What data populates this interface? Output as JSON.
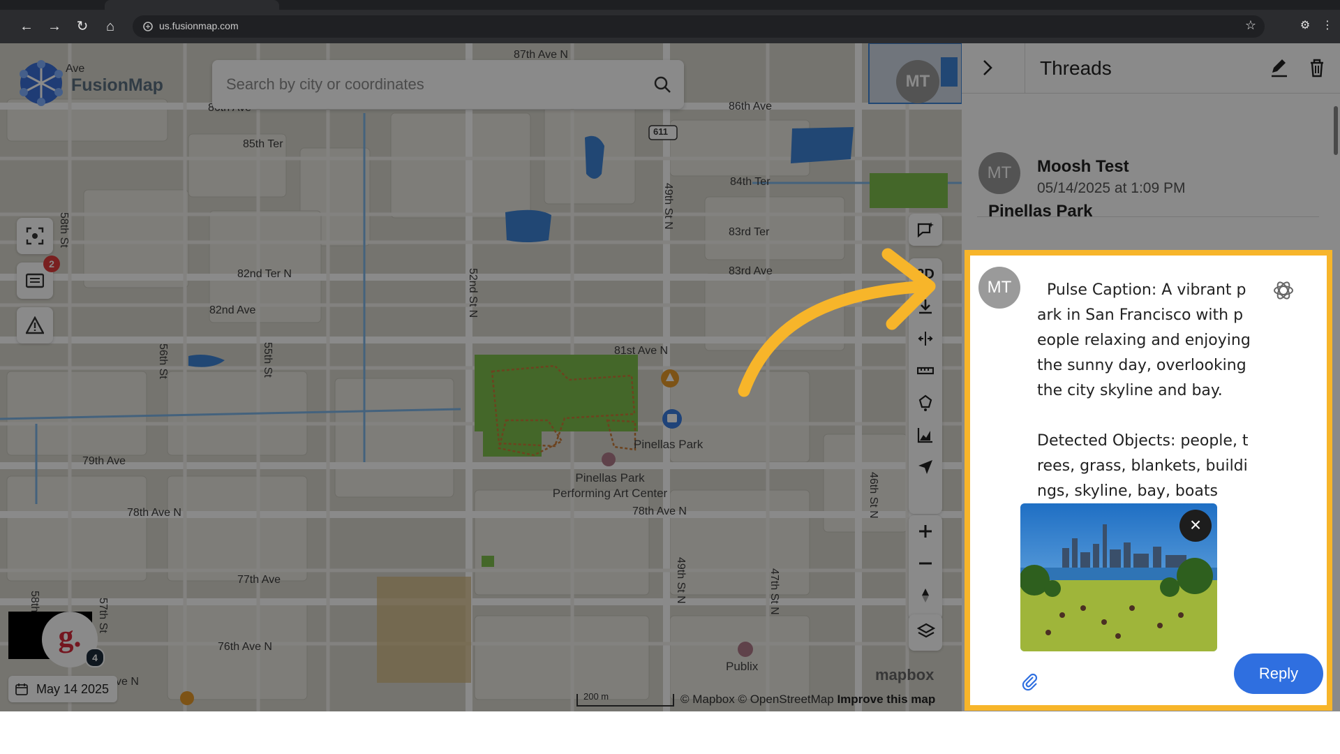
{
  "browser": {
    "url": "us.fusionmap.com"
  },
  "app": {
    "logo_text": "FusionMap",
    "search_placeholder": "Search by city or coordinates",
    "user_initials": "MT",
    "notification_count": "2",
    "right_tools": {
      "mode_label": "2D"
    },
    "date": "May 14 2025",
    "g_badge_count": "4"
  },
  "map": {
    "streets": {
      "s_87th_ave_n": "87th Ave N",
      "s_86th_ave_top": "86th Ave",
      "s_86th_ave_left": "86th Ave",
      "s_ave": "Ave",
      "s_85th_ter": "85th Ter",
      "s_84th_ter": "84th Ter",
      "s_83rd_ter": "83rd Ter",
      "s_83rd_ave": "83rd Ave",
      "s_82nd_ter_n": "82nd Ter N",
      "s_82nd_ave": "82nd Ave",
      "s_81st_ave_n": "81st Ave N",
      "s_79th_ave": "79th Ave",
      "s_78th_ave_n_left": "78th Ave N",
      "s_78th_ave_n_right": "78th Ave N",
      "s_77th_ave": "77th Ave",
      "s_76th_ave_n": "76th Ave N",
      "s_ve_n": "ve N",
      "s_58th_st": "58th St",
      "s_56th_st": "56th St",
      "s_55th_st": "55th St",
      "s_52nd_st_n": "52nd St N",
      "s_49th_st_n_top": "49th St N",
      "s_49th_st_n_bottom": "49th St N",
      "s_47th_st_n": "47th St N",
      "s_46th_st_n": "46th St N",
      "s_58th_bottom": "58th",
      "s_57th_st": "57th St",
      "route_611": "611"
    },
    "pois": {
      "pinellas_park": "Pinellas Park",
      "pac_line1": "Pinellas Park",
      "pac_line2": "Performing Art Center",
      "publix": "Publix"
    },
    "scale_label": "200 m",
    "attribution": "© Mapbox © OpenStreetMap",
    "improve_link": "Improve this map",
    "mapbox_logo": "mapbox"
  },
  "threads": {
    "title": "Threads",
    "first_message": {
      "initials": "MT",
      "author": "Moosh Test",
      "timestamp": "05/14/2025 at 1:09 PM",
      "location_title": "Pinellas Park"
    },
    "caption_message": {
      "initials": "MT",
      "text": "  Pulse Caption: A vibrant park in San Francisco with people relaxing and enjoying the sunny day, overlooking the city skyline and bay.\n\nDetected Objects: people, trees, grass, blankets, buildings, skyline, bay, boats",
      "close_label": "×",
      "reply_label": "Reply"
    }
  },
  "colors": {
    "highlight": "#f7b52a",
    "reply_button": "#2f6fe0",
    "avatar_gray": "#9a9a9a",
    "park_green": "#7fbf4d",
    "water_blue": "#3d84d6"
  }
}
